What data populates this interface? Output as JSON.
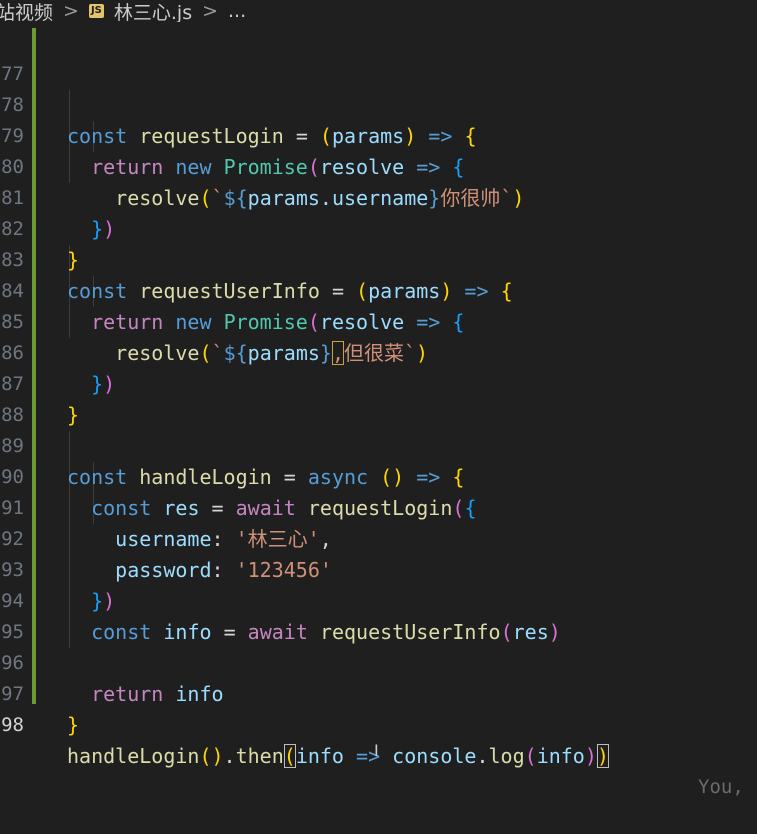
{
  "breadcrumb": {
    "folder": "站视频",
    "sep": ">",
    "file_badge": "JS",
    "file_name": "林三心.js",
    "more": "..."
  },
  "line_numbers": [
    "77",
    "78",
    "79",
    "80",
    "81",
    "82",
    "83",
    "84",
    "85",
    "86",
    "87",
    "88",
    "89",
    "90",
    "91",
    "92",
    "93",
    "94",
    "95",
    "96",
    "97",
    "98"
  ],
  "tokens": {
    "const": "const",
    "return": "return",
    "new": "new",
    "async": "async",
    "await": "await",
    "requestLogin": "requestLogin",
    "requestUserInfo": "requestUserInfo",
    "handleLogin": "handleLogin",
    "params": "params",
    "resolve": "resolve",
    "Promise": "Promise",
    "arrow": "=>",
    "eq": "=",
    "lparen": "(",
    "rparen": ")",
    "lbrace": "{",
    "rbrace": "}",
    "backtick": "`",
    "tpl_open": "${",
    "tpl_close": "}",
    "dot_username": ".username",
    "str_ni_hen_shuai": "你很帅",
    "comma": ",",
    "str_dan_hen_cai": "但很菜",
    "res": "res",
    "info": "info",
    "username_key": "username",
    "password_key": "password",
    "colon": ":",
    "str_lin": "'林三心'",
    "str_pwd": "'123456'",
    "then": "then",
    "console": "console",
    "log": "log",
    "dot": ".",
    "empty_parens": "()"
  },
  "ghost_text": "You,"
}
